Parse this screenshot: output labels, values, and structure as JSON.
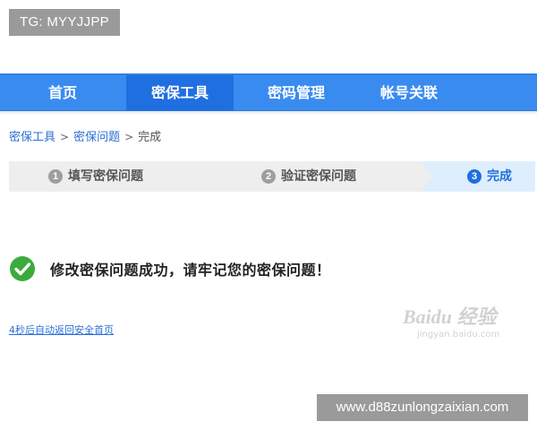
{
  "overlay": {
    "tag": "TG: MYYJJPP",
    "url": "www.d88zunlongzaixian.com"
  },
  "nav": {
    "items": [
      {
        "label": "首页",
        "active": false
      },
      {
        "label": "密保工具",
        "active": true
      },
      {
        "label": "密码管理",
        "active": false
      },
      {
        "label": "帐号关联",
        "active": false
      }
    ]
  },
  "breadcrumb": {
    "items": [
      "密保工具",
      "密保问题"
    ],
    "current": "完成",
    "separator": ">"
  },
  "steps": [
    {
      "number": "1",
      "label": "填写密保问题"
    },
    {
      "number": "2",
      "label": "验证密保问题"
    },
    {
      "number": "3",
      "label": "完成"
    }
  ],
  "success": {
    "icon": "check-circle-icon",
    "message": "修改密保问题成功，请牢记您的密保问题！"
  },
  "return_link": "4秒后自动返回安全首页",
  "watermark": {
    "brand": "Baidu 经验",
    "sub": "jingyan.baidu.com"
  },
  "colors": {
    "nav_bg": "#3a8bf0",
    "nav_active": "#1f6fe0",
    "link": "#2a6fd6",
    "success_green": "#3cab3c",
    "step_active_bg": "#dfeefd"
  }
}
